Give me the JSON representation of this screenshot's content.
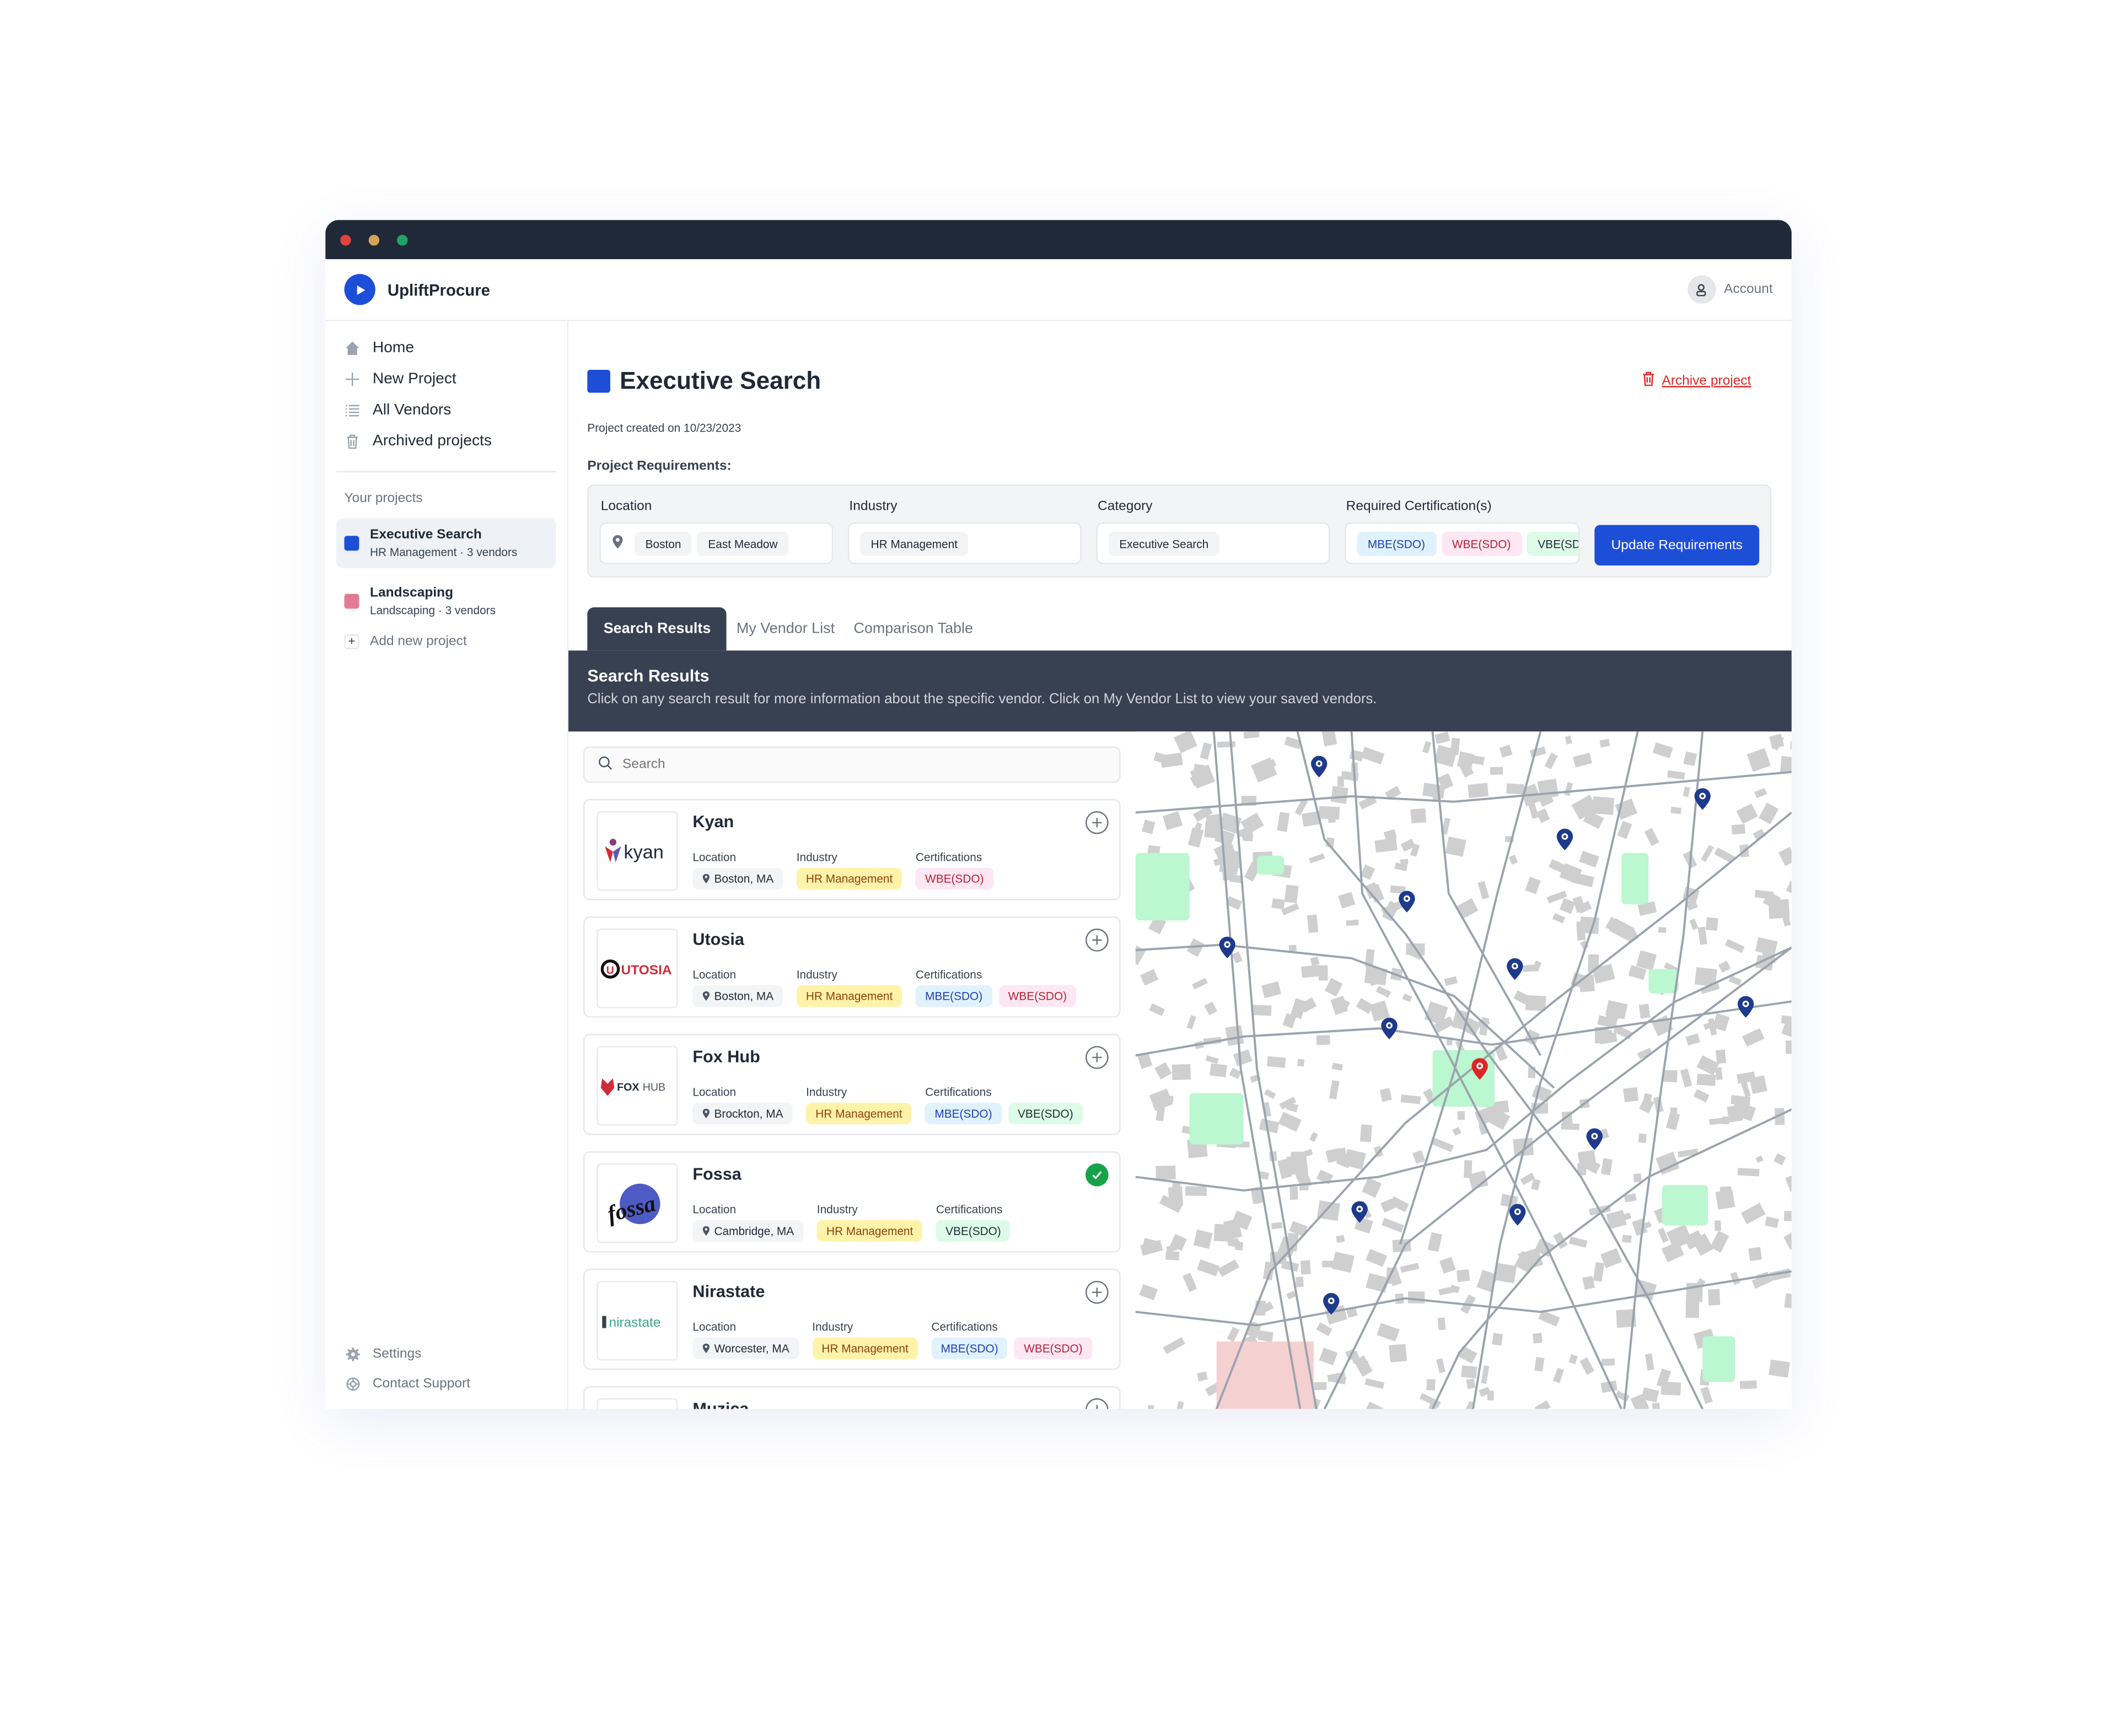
{
  "window": {
    "brand": {
      "name": "UpliftProcure",
      "icon": "play-logo-icon",
      "color": "#1d4ed8"
    },
    "account": {
      "label": "Account",
      "icon": "user-icon"
    }
  },
  "sidebar": {
    "nav": [
      {
        "label": "Home",
        "icon": "home-icon"
      },
      {
        "label": "New Project",
        "icon": "plus-icon"
      },
      {
        "label": "All Vendors",
        "icon": "list-icon"
      },
      {
        "label": "Archived projects",
        "icon": "trash-icon"
      }
    ],
    "projects_heading": "Your projects",
    "projects": [
      {
        "title": "Executive Search",
        "subtitle": "HR Management · 3 vendors",
        "color": "#1d4ed8",
        "active": true
      },
      {
        "title": "Landscaping",
        "subtitle": "Landscaping · 3 vendors",
        "color": "#e07b93",
        "active": false
      }
    ],
    "add_project_label": "Add new project",
    "bottom": [
      {
        "label": "Settings",
        "icon": "gear-icon"
      },
      {
        "label": "Contact Support",
        "icon": "lifebuoy-icon"
      }
    ]
  },
  "project": {
    "title": "Executive Search",
    "color": "#1d4ed8",
    "archive_label": "Archive project",
    "created": "Project created on 10/23/2023",
    "requirements_label": "Project Requirements:",
    "requirements": {
      "location": {
        "label": "Location",
        "values": [
          "Boston",
          "East Meadow"
        ]
      },
      "industry": {
        "label": "Industry",
        "values": [
          "HR Management"
        ]
      },
      "category": {
        "label": "Category",
        "values": [
          "Executive Search"
        ]
      },
      "certifications": {
        "label": "Required Certification(s)",
        "values": [
          "MBE(SDO)",
          "WBE(SDO)",
          "VBE(SDO)"
        ]
      }
    },
    "update_button": "Update Requirements"
  },
  "tabs": [
    {
      "label": "Search Results",
      "active": true
    },
    {
      "label": "My Vendor List",
      "active": false
    },
    {
      "label": "Comparison Table",
      "active": false
    }
  ],
  "results": {
    "title": "Search Results",
    "description": "Click on any search result for more information about the specific vendor. Click on My Vendor List to view your saved vendors.",
    "search_placeholder": "Search",
    "labels": {
      "location": "Location",
      "industry": "Industry",
      "certifications": "Certifications"
    },
    "vendors": [
      {
        "name": "Kyan",
        "logo_text": "kyan",
        "location": "Boston, MA",
        "industry": "HR Management",
        "certifications": [
          "WBE(SDO)"
        ],
        "added": false
      },
      {
        "name": "Utosia",
        "logo_text": "UTOSIA",
        "location": "Boston, MA",
        "industry": "HR Management",
        "certifications": [
          "MBE(SDO)",
          "WBE(SDO)"
        ],
        "added": false
      },
      {
        "name": "Fox Hub",
        "logo_text": "FOX HUB",
        "location": "Brockton, MA",
        "industry": "HR Management",
        "certifications": [
          "MBE(SDO)",
          "VBE(SDO)"
        ],
        "added": false
      },
      {
        "name": "Fossa",
        "logo_text": "fossa",
        "location": "Cambridge, MA",
        "industry": "HR Management",
        "certifications": [
          "VBE(SDO)"
        ],
        "added": true
      },
      {
        "name": "Nirastate",
        "logo_text": "nirastate",
        "location": "Worcester, MA",
        "industry": "HR Management",
        "certifications": [
          "MBE(SDO)",
          "WBE(SDO)"
        ],
        "added": false
      },
      {
        "name": "Muzica",
        "logo_text": "",
        "location": "",
        "industry": "",
        "certifications": [],
        "added": false
      }
    ]
  },
  "map": {
    "vendor_marker_color": "#1e3a8a",
    "project_marker_color": "#dc2626",
    "vendor_markers": 12,
    "project_markers": 1
  },
  "colors": {
    "accent": "#1d4ed8",
    "dark": "#374151",
    "danger": "#dc2626",
    "success": "#16a34a"
  }
}
